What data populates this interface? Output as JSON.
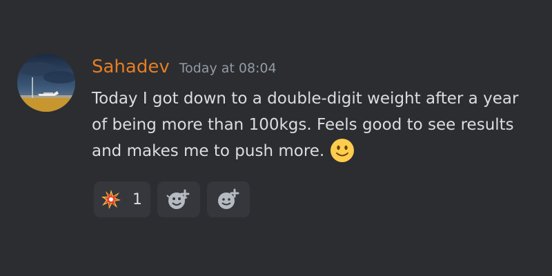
{
  "message": {
    "author": "Sahadev",
    "timestamp": "Today at 08:04",
    "text": "Today I got down to a double-digit weight after a year of being more than 100kgs. Feels good to see results and makes me to push more.",
    "inline_emoji": "slightly-smiling-face-icon"
  },
  "reactions": [
    {
      "icon": "collision-icon",
      "count": "1"
    },
    {
      "icon": "add-reaction-icon"
    },
    {
      "icon": "add-super-reaction-icon"
    }
  ],
  "colors": {
    "background": "#2b2d31",
    "username": "#e67e22",
    "timestamp": "#949ba4",
    "text": "#dbdee1",
    "reaction_bg": "#35373c"
  }
}
